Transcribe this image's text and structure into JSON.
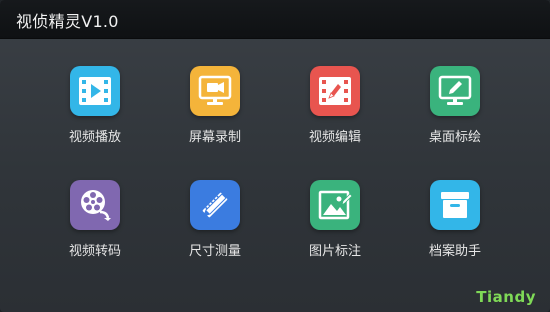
{
  "window": {
    "title": "视侦精灵V1.0"
  },
  "tools": [
    {
      "label": "视频播放",
      "icon": "video-play-icon",
      "color": "#33b6e8"
    },
    {
      "label": "屏幕录制",
      "icon": "screen-record-icon",
      "color": "#f4b43a"
    },
    {
      "label": "视频编辑",
      "icon": "video-edit-icon",
      "color": "#e8554f"
    },
    {
      "label": "桌面标绘",
      "icon": "desktop-annotate-icon",
      "color": "#3ab37d"
    },
    {
      "label": "视频转码",
      "icon": "video-transcode-icon",
      "color": "#8068b0"
    },
    {
      "label": "尺寸测量",
      "icon": "size-measure-icon",
      "color": "#3b7ce0"
    },
    {
      "label": "图片标注",
      "icon": "image-annotate-icon",
      "color": "#3ab37d"
    },
    {
      "label": "档案助手",
      "icon": "archive-assistant-icon",
      "color": "#33b6e8"
    }
  ],
  "brand": {
    "text": "Tiandy",
    "color": "#7fd957"
  }
}
